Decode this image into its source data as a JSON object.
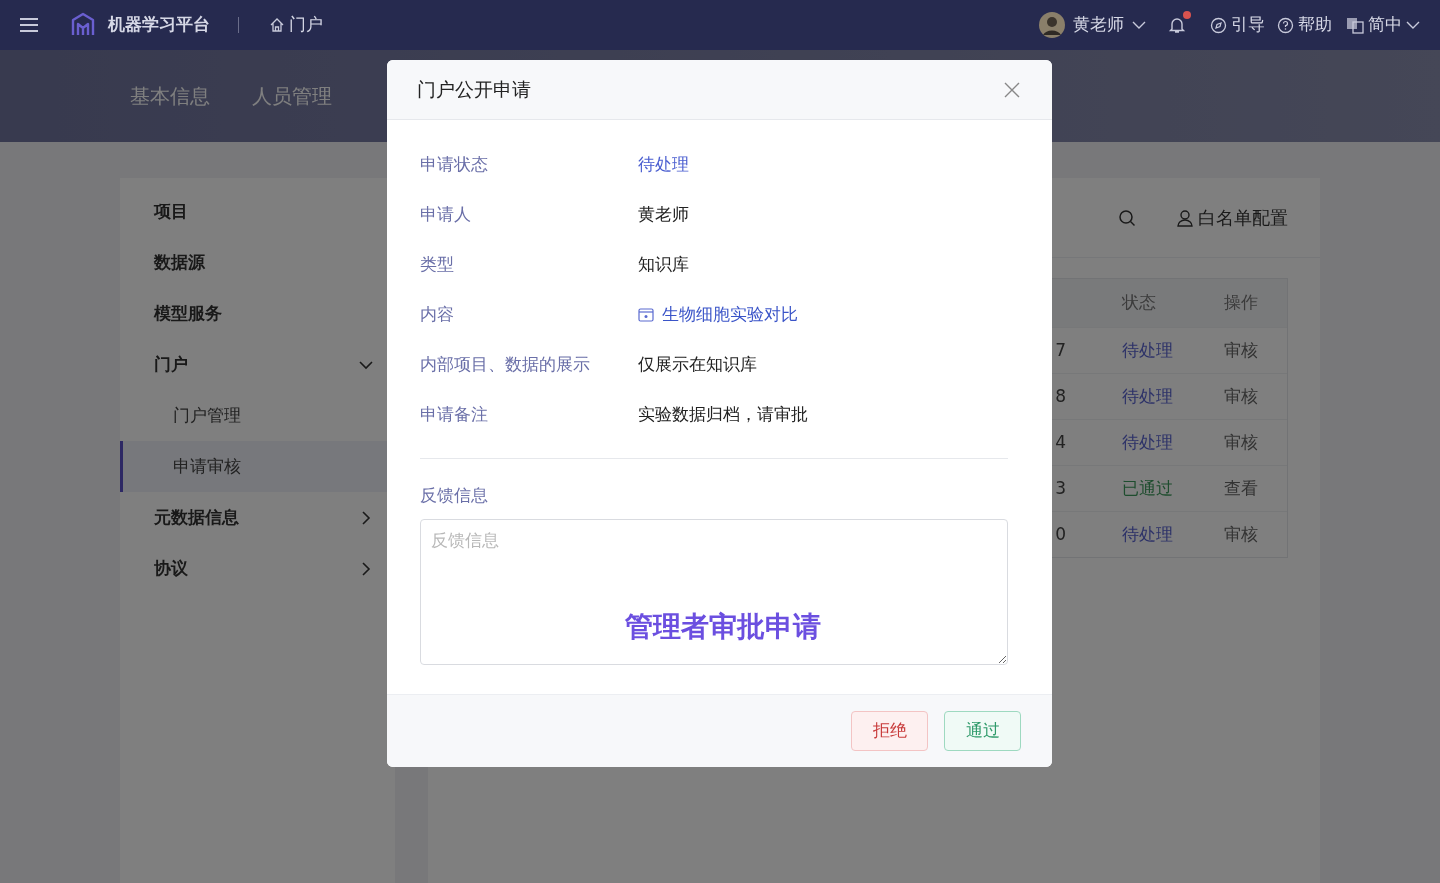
{
  "header": {
    "platform_name": "机器学习平台",
    "breadcrumb": "门户",
    "user": "黄老师",
    "notification_badge": true,
    "links": [
      {
        "kind": "guide",
        "label": "引导"
      },
      {
        "kind": "help",
        "label": "帮助"
      }
    ],
    "language": "简中"
  },
  "tabs": [
    {
      "label": "基本信息"
    },
    {
      "label": "人员管理"
    }
  ],
  "sidebar": {
    "items": [
      {
        "label": "项目",
        "kind": "leaf"
      },
      {
        "label": "数据源",
        "kind": "leaf"
      },
      {
        "label": "模型服务",
        "kind": "leaf"
      },
      {
        "label": "门户",
        "kind": "group",
        "expanded": true,
        "children": [
          {
            "label": "门户管理",
            "selected": false
          },
          {
            "label": "申请审核",
            "selected": true
          }
        ]
      },
      {
        "label": "元数据信息",
        "kind": "group",
        "expanded": false
      },
      {
        "label": "协议",
        "kind": "group",
        "expanded": false
      }
    ]
  },
  "toolbar": {
    "whitelist_button": "白名单配置"
  },
  "table": {
    "columns": [
      {
        "label": "状态"
      },
      {
        "label": "操作"
      }
    ],
    "rows": [
      {
        "column_1": "7",
        "status": "待处理",
        "kind": "pending",
        "action": "审核"
      },
      {
        "column_1": "8",
        "status": "待处理",
        "kind": "pending",
        "action": "审核"
      },
      {
        "column_1": "4",
        "status": "待处理",
        "kind": "pending",
        "action": "审核"
      },
      {
        "column_1": "3",
        "status": "已通过",
        "kind": "approved",
        "action": "查看"
      },
      {
        "column_1": "0",
        "status": "待处理",
        "kind": "pending",
        "action": "审核"
      }
    ]
  },
  "modal": {
    "title": "门户公开申请",
    "fields": [
      {
        "label": "申请状态",
        "value": "待处理",
        "kind": "status"
      },
      {
        "label": "申请人",
        "value": "黄老师",
        "kind": "text"
      },
      {
        "label": "类型",
        "value": "知识库",
        "kind": "text"
      },
      {
        "label": "内容",
        "value": "生物细胞实验对比",
        "kind": "link"
      },
      {
        "label": "内部项目、数据的展示",
        "value": "仅展示在知识库",
        "kind": "text"
      },
      {
        "label": "申请备注",
        "value": "实验数据归档，请审批",
        "kind": "text"
      }
    ],
    "feedback": {
      "label": "反馈信息",
      "placeholder": "反馈信息"
    },
    "caption": "管理者审批申请",
    "buttons": [
      {
        "label": "拒绝",
        "kind": "reject"
      },
      {
        "label": "通过",
        "kind": "approve"
      }
    ]
  }
}
